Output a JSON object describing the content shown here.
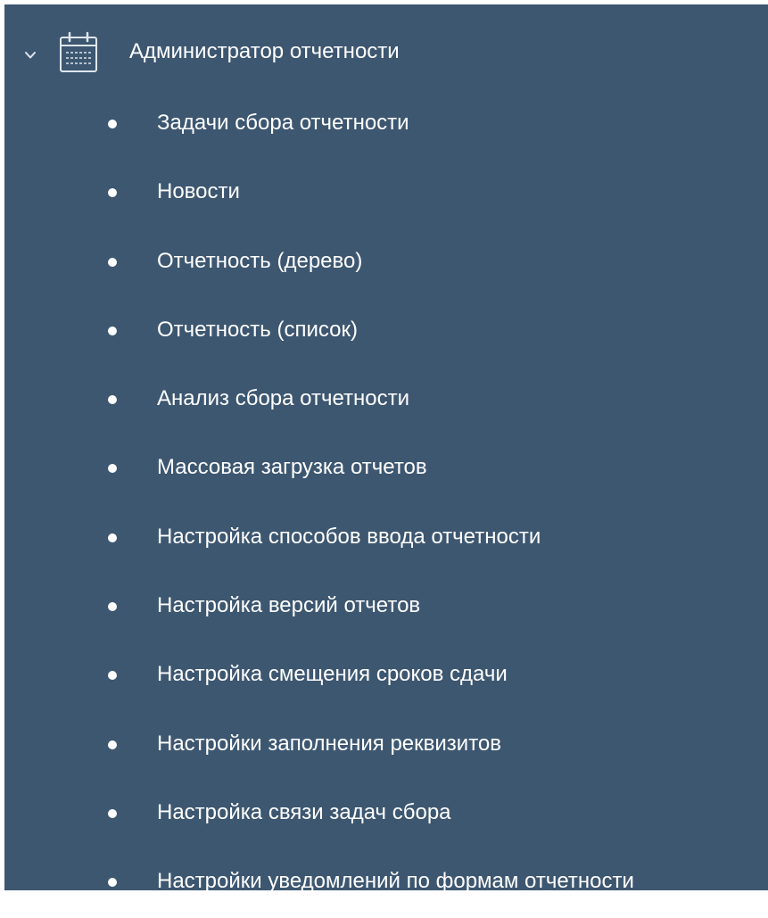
{
  "colors": {
    "panel_background": "#3d5771",
    "text": "#ffffff",
    "icon_stroke": "#dfe6ee"
  },
  "group": {
    "label": "Администратор отчетности",
    "expand_icon": "chevron-down-icon",
    "icon": "calendar-icon",
    "expanded": true
  },
  "menu": {
    "items": [
      {
        "label": "Задачи сбора отчетности"
      },
      {
        "label": "Новости"
      },
      {
        "label": "Отчетность (дерево)"
      },
      {
        "label": "Отчетность (список)"
      },
      {
        "label": "Анализ сбора отчетности"
      },
      {
        "label": "Массовая загрузка отчетов"
      },
      {
        "label": "Настройка способов ввода отчетности"
      },
      {
        "label": "Настройка версий отчетов"
      },
      {
        "label": "Настройка смещения сроков сдачи"
      },
      {
        "label": "Настройки заполнения реквизитов"
      },
      {
        "label": "Настройка связи задач сбора"
      },
      {
        "label": "Настройки уведомлений по формам отчетности"
      }
    ]
  }
}
